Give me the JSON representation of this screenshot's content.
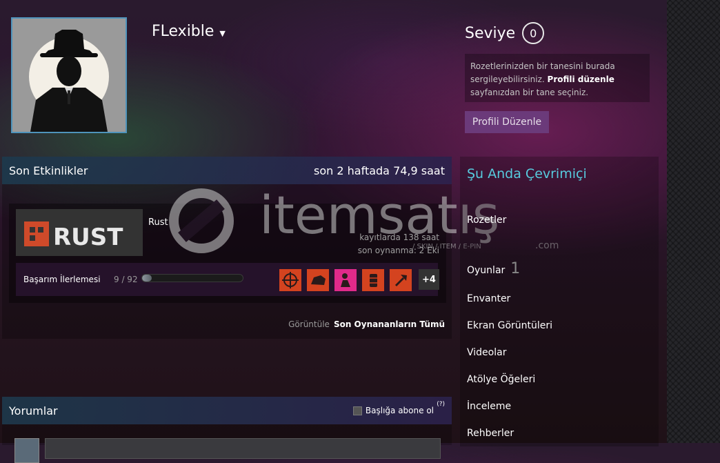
{
  "profile": {
    "username": "FLexible"
  },
  "level": {
    "label": "Seviye",
    "value": "0"
  },
  "badge_info": {
    "text_before": "Rozetlerinizden bir tanesini burada sergileyebilirsiniz.",
    "link": "Profili düzenle",
    "text_after": "sayfanızdan bir tane seçiniz."
  },
  "edit_button": "Profili Düzenle",
  "activity": {
    "title": "Son Etkinlikler",
    "hours_summary": "son 2 haftada 74,9 saat",
    "game": {
      "name": "Rust",
      "hours_on_record": "kayıtlarda 138 saat",
      "last_played": "son oynanma: 2 Eki",
      "achievements_label": "Başarım İlerlemesi",
      "achievements_count": "9 / 92",
      "achievements_progress": 0.098,
      "more_achievements": "+4"
    },
    "view_label": "Görüntüle",
    "view_link": "Son Oynananların Tümü"
  },
  "watermark": {
    "brand": "itemsatış",
    "tagline": "/ SKIN / ITEM / E-PIN",
    "suffix": ".com"
  },
  "comments": {
    "title": "Yorumlar",
    "subscribe": "Başlığa abone ol",
    "help": "(?)"
  },
  "sidebar": {
    "online": "Şu Anda Çevrimiçi",
    "items": [
      {
        "label": "Rozetler",
        "count": ""
      },
      {
        "label": "Oyunlar",
        "count": "1"
      },
      {
        "label": "Envanter",
        "count": ""
      },
      {
        "label": "Ekran Görüntüleri",
        "count": ""
      },
      {
        "label": "Videolar",
        "count": ""
      },
      {
        "label": "Atölye Öğeleri",
        "count": ""
      },
      {
        "label": "İnceleme",
        "count": ""
      },
      {
        "label": "Rehberler",
        "count": ""
      }
    ]
  },
  "colors": {
    "accent_online": "#57cbde",
    "edit_button": "#6b3a7a",
    "achievement_icon": "#d4431f"
  },
  "icons": [
    "avatar-silhouette",
    "rust-logo",
    "achievement-icons"
  ]
}
